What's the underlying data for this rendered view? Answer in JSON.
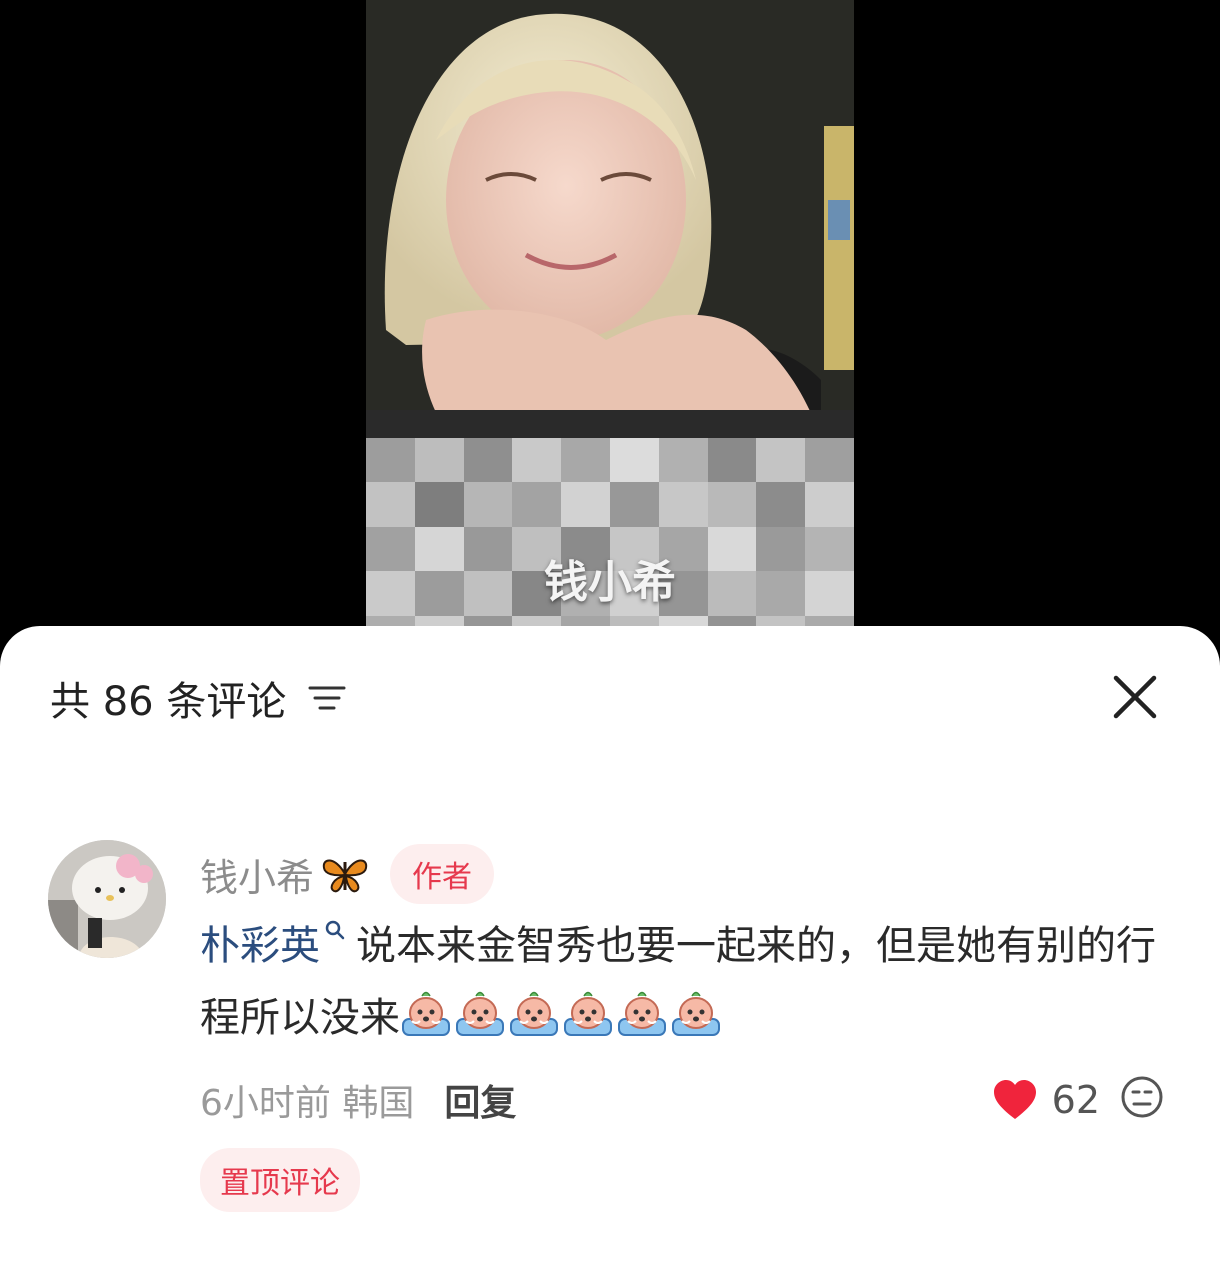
{
  "video": {
    "subtitle": "钱小希"
  },
  "sheet": {
    "comment_count_label": "共 86 条评论",
    "filter_icon": "filter-icon",
    "close_icon": "close-icon"
  },
  "comment": {
    "author": "钱小希",
    "author_emoji": "butterfly-icon",
    "author_tag": "作者",
    "mention": "朴彩英",
    "text": "说本来金智秀也要一起来的，但是她有别的行程所以没来",
    "emoji_count": 6,
    "time_location": "6小时前 韩国",
    "reply_label": "回复",
    "like_count": "62",
    "pinned_label": "置顶评论"
  },
  "colors": {
    "accent_red": "#e6394d",
    "mention_blue": "#2b4d7e",
    "tag_bg": "#fdeeee"
  }
}
